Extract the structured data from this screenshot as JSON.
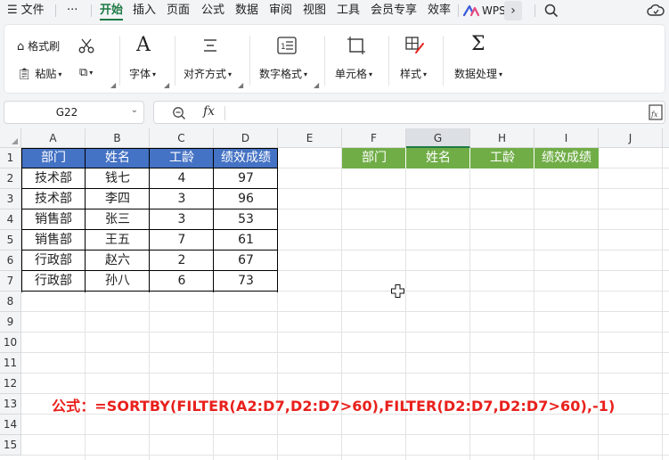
{
  "menubar": {
    "items": [
      "文件",
      "开始",
      "插入",
      "页面",
      "公式",
      "数据",
      "审阅",
      "视图",
      "工具",
      "会员专享",
      "效率"
    ],
    "more": "···",
    "wps_label": "WPS"
  },
  "ribbon": {
    "format_painter": "格式刷",
    "paste": "粘贴",
    "font": "字体",
    "alignment": "对齐方式",
    "number_format": "数字格式",
    "cell": "单元格",
    "style": "样式",
    "data_processing": "数据处理"
  },
  "formula_bar": {
    "name_box": "G22",
    "fx_label": "fx",
    "content": ""
  },
  "sheet": {
    "columns": [
      "A",
      "B",
      "C",
      "D",
      "E",
      "F",
      "G",
      "H",
      "I",
      "J"
    ],
    "rows": [
      "1",
      "2",
      "3",
      "4",
      "5",
      "6",
      "7",
      "8",
      "9",
      "10",
      "11",
      "12",
      "13",
      "14",
      "15"
    ],
    "selected_column": "G",
    "source_table": {
      "headers": [
        "部门",
        "姓名",
        "工龄",
        "绩效成绩"
      ],
      "rows": [
        [
          "技术部",
          "钱七",
          "4",
          "97"
        ],
        [
          "技术部",
          "李四",
          "3",
          "96"
        ],
        [
          "销售部",
          "张三",
          "3",
          "53"
        ],
        [
          "销售部",
          "王五",
          "7",
          "61"
        ],
        [
          "行政部",
          "赵六",
          "2",
          "67"
        ],
        [
          "行政部",
          "孙八",
          "6",
          "73"
        ]
      ]
    },
    "result_headers": [
      "部门",
      "姓名",
      "工龄",
      "绩效成绩"
    ],
    "formula_note": "公式：=SORTBY(FILTER(A2:D7,D2:D7>60),FILTER(D2:D7,D2:D7>60),-1)"
  },
  "colors": {
    "blue_header": "#4472c4",
    "green_header": "#70ad47",
    "formula_text": "#e8201c",
    "active_tab": "#1f7a45"
  }
}
